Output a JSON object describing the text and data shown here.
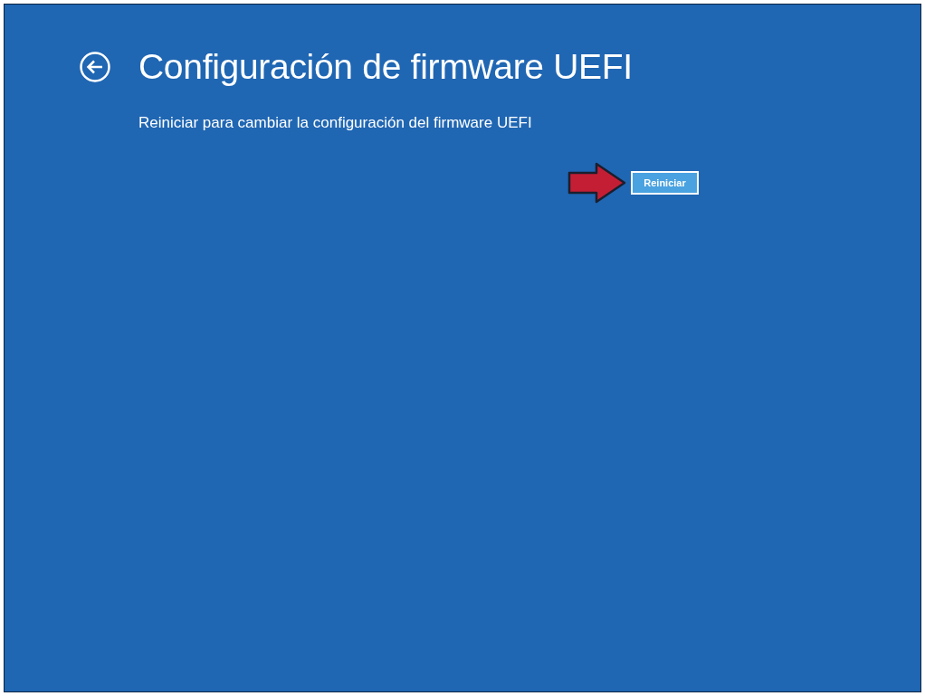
{
  "page": {
    "title": "Configuración de firmware UEFI",
    "description": "Reiniciar para cambiar la configuración del firmware UEFI"
  },
  "restart_button": {
    "label": "Reiniciar"
  }
}
